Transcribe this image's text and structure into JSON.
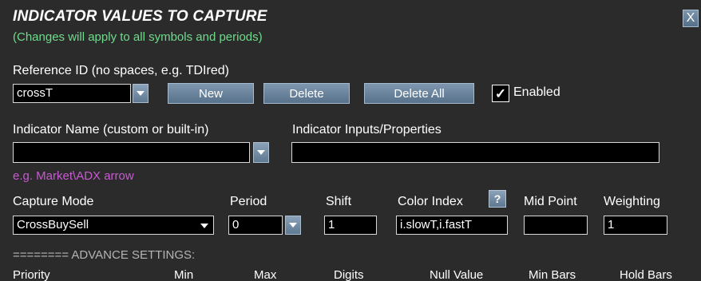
{
  "dialog": {
    "title": "INDICATOR VALUES TO CAPTURE",
    "subtitle": "(Changes will apply to all symbols and periods)",
    "close_label": "X"
  },
  "reference": {
    "label": "Reference ID (no spaces, e.g. TDIred)",
    "value": "crossT",
    "new_label": "New",
    "delete_label": "Delete",
    "delete_all_label": "Delete All",
    "enabled_checked": "✓",
    "enabled_label": "Enabled"
  },
  "indicator": {
    "name_label": "Indicator Name (custom or built-in)",
    "name_value": "",
    "inputs_label": "Indicator Inputs/Properties",
    "inputs_value": "",
    "hint": "e.g. Market\\ADX arrow"
  },
  "capture": {
    "mode_label": "Capture Mode",
    "mode_value": "CrossBuySell",
    "period_label": "Period",
    "period_value": "0",
    "shift_label": "Shift",
    "shift_value": "1",
    "color_index_label": "Color Index",
    "color_index_help": "?",
    "color_index_value": "i.slowT,i.fastT",
    "mid_point_label": "Mid Point",
    "mid_point_value": "",
    "weighting_label": "Weighting",
    "weighting_value": "1"
  },
  "advanced": {
    "header": "======== ADVANCE SETTINGS:",
    "columns": [
      "Priority",
      "Min",
      "Max",
      "Digits",
      "Null Value",
      "Min Bars",
      "Hold Bars"
    ]
  },
  "icons": {
    "dropdown": "chevron-down-icon",
    "close": "close-icon",
    "check": "check-icon",
    "help": "question-icon"
  },
  "colors": {
    "background": "#2b2b2b",
    "subtitle": "#6fdc8c",
    "hint": "#c85ad2",
    "button": "#6a849e",
    "field_bg": "#000000"
  }
}
